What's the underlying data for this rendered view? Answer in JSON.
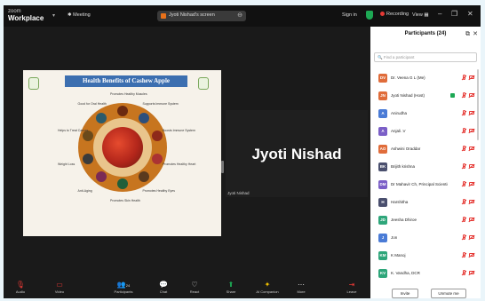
{
  "app": {
    "line1": "zoom",
    "line2": "Workplace"
  },
  "topbar": {
    "meeting": "Meeting",
    "share_tab": "Jyoti Nishad's screen",
    "sign_in": "Sign in",
    "recording": "Recording",
    "view": "View"
  },
  "slide": {
    "title": "Health Benefits of Cashew Apple",
    "benefits": [
      "Promotes Healthy Muscles",
      "Supports Immune System",
      "Boosts Immune System",
      "Promotes Healthy Heart",
      "Promotes Healthy Eyes",
      "Promotes Skin Health",
      "Anti-Aging",
      "Weight Loss",
      "Helps to Treat Cancer",
      "Good for Oral Health"
    ]
  },
  "video": {
    "name": "Jyoti Nishad",
    "label": "Jyoti Nishad"
  },
  "panel": {
    "title": "Participants (24)",
    "search_placeholder": "Find a participant",
    "invite": "Invite",
    "unmute_me": "Unmute me",
    "participants": [
      {
        "initials": "DV",
        "name": "Dr. Veena G L (Me)",
        "color": "#e06c3a"
      },
      {
        "initials": "JN",
        "name": "Jyoti Nishad (Host)",
        "color": "#e06c3a"
      },
      {
        "initials": "A",
        "name": "Anirudha",
        "color": "#4a7bd6"
      },
      {
        "initials": "A",
        "name": "Anjali .V",
        "color": "#7b5fc7"
      },
      {
        "initials": "AO",
        "name": "Ashwini Oraddar",
        "color": "#e06c3a"
      },
      {
        "initials": "BK",
        "name": "Brijith krishna",
        "color": "#4a4f6e"
      },
      {
        "initials": "DM",
        "name": "Dr Mahavir Ch, Principal Scientis...",
        "color": "#7b5fc7"
      },
      {
        "initials": "H",
        "name": "Harshitha",
        "color": "#4a4f6e"
      },
      {
        "initials": "JD",
        "name": "Jeesha Dhiroe",
        "color": "#2ea67a"
      },
      {
        "initials": "J",
        "name": "Jon",
        "color": "#4a7bd6"
      },
      {
        "initials": "KM",
        "name": "K Manoj",
        "color": "#2ea67a"
      },
      {
        "initials": "KV",
        "name": "K. Vandha, DCR",
        "color": "#2ea67a"
      }
    ]
  },
  "toolbar": {
    "audio": "Audio",
    "video": "Video",
    "participants": "Participants",
    "participants_count": "24",
    "chat": "Chat",
    "react": "React",
    "share": "Share",
    "ai_companion": "AI Companion",
    "more": "More",
    "leave": "Leave"
  },
  "colors": {
    "host_green": "#1da854",
    "recording_red": "#e53935",
    "slide_title_blue": "#3c6fb0"
  }
}
